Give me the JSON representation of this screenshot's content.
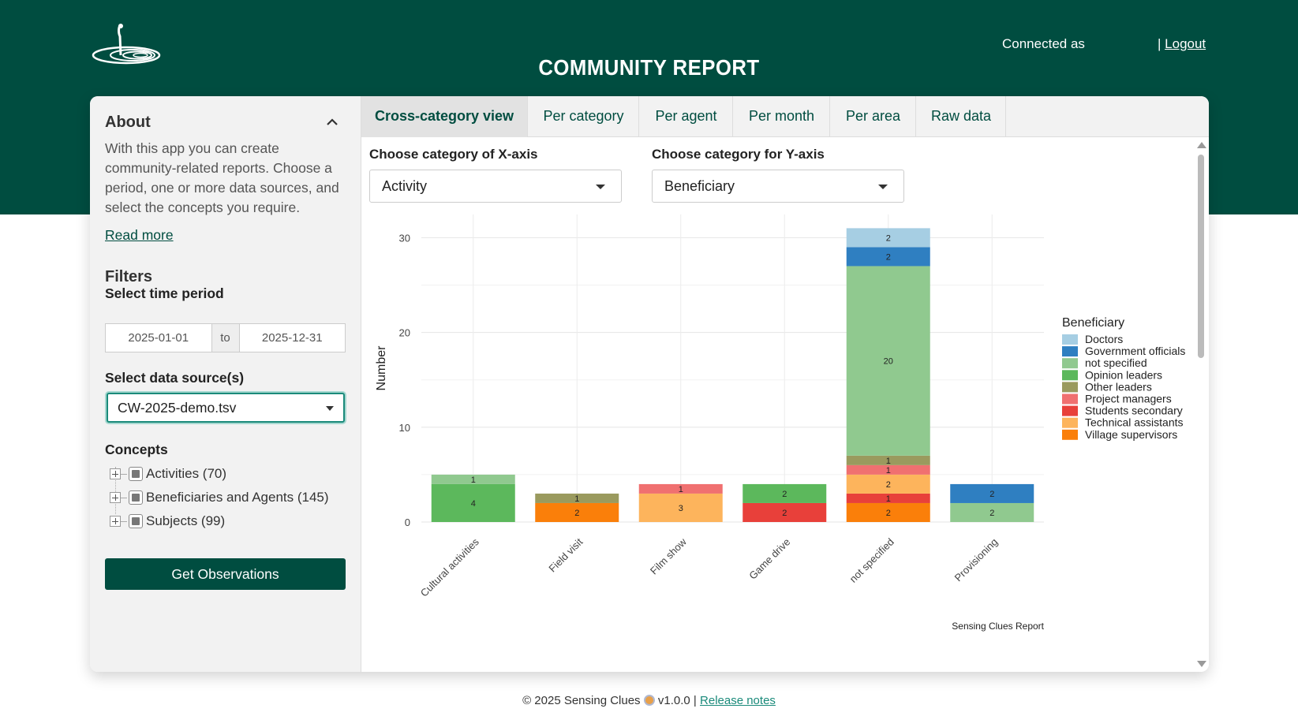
{
  "header": {
    "title": "COMMUNITY REPORT",
    "connected_label": "Connected as",
    "logout_prefix": "|",
    "logout_label": "Logout"
  },
  "sidebar": {
    "about_title": "About",
    "about_text": "With this app you can create community-related reports. Choose a period, one or more data sources, and select the concepts you require.",
    "read_more": "Read more",
    "filters_title": "Filters",
    "time_period_label": "Select time period",
    "date_start": "2025-01-01",
    "date_sep": "to",
    "date_end": "2025-12-31",
    "data_source_label": "Select data source(s)",
    "data_source_value": "CW-2025-demo.tsv",
    "concepts_label": "Concepts",
    "concepts": [
      {
        "label": "Activities (70)"
      },
      {
        "label": "Beneficiaries and Agents (145)"
      },
      {
        "label": "Subjects (99)"
      }
    ],
    "get_button": "Get Observations"
  },
  "tabs": [
    {
      "label": "Cross-category view",
      "active": true
    },
    {
      "label": "Per category",
      "active": false
    },
    {
      "label": "Per agent",
      "active": false
    },
    {
      "label": "Per month",
      "active": false
    },
    {
      "label": "Per area",
      "active": false
    },
    {
      "label": "Raw data",
      "active": false
    }
  ],
  "controls": {
    "x_label": "Choose category of X-axis",
    "x_value": "Activity",
    "y_label": "Choose category for Y-axis",
    "y_value": "Beneficiary"
  },
  "chart_data": {
    "type": "bar",
    "stacked": true,
    "categories": [
      "Cultural activities",
      "Field visit",
      "Film show",
      "Game drive",
      "not specified",
      "Provisioning"
    ],
    "ylabel": "Number",
    "xlabel": "",
    "ylim": [
      0,
      32
    ],
    "yticks": [
      0,
      10,
      20,
      30
    ],
    "grid": true,
    "legend_title": "Beneficiary",
    "legend_position": "right",
    "caption": "Sensing Clues Report",
    "series": [
      {
        "name": "Doctors",
        "color": "#a6cee3",
        "values": [
          0,
          0,
          0,
          0,
          2,
          0
        ]
      },
      {
        "name": "Government officials",
        "color": "#2f7fc1",
        "values": [
          0,
          0,
          0,
          0,
          2,
          2
        ]
      },
      {
        "name": "not specified",
        "color": "#90c98f",
        "values": [
          1,
          0,
          0,
          0,
          20,
          2
        ]
      },
      {
        "name": "Opinion leaders",
        "color": "#5cb85c",
        "values": [
          4,
          0,
          0,
          2,
          0,
          0
        ]
      },
      {
        "name": "Other leaders",
        "color": "#9a9a5e",
        "values": [
          0,
          1,
          0,
          0,
          1,
          0
        ]
      },
      {
        "name": "Project managers",
        "color": "#f07070",
        "values": [
          0,
          0,
          1,
          0,
          1,
          0
        ]
      },
      {
        "name": "Students secondary",
        "color": "#e8403a",
        "values": [
          0,
          0,
          0,
          2,
          1,
          0
        ]
      },
      {
        "name": "Technical assistants",
        "color": "#fdb45c",
        "values": [
          0,
          0,
          3,
          0,
          2,
          0
        ]
      },
      {
        "name": "Village supervisors",
        "color": "#fa7f0a",
        "values": [
          0,
          2,
          0,
          0,
          2,
          0
        ]
      }
    ],
    "stack_order_bottom_to_top": [
      "Village supervisors",
      "Students secondary",
      "Technical assistants",
      "Project managers",
      "Other leaders",
      "Opinion leaders",
      "not specified",
      "Government officials",
      "Doctors"
    ]
  },
  "footer": {
    "copyright": "© 2025 Sensing Clues",
    "version": "v1.0.0 |",
    "release_notes": "Release notes"
  }
}
